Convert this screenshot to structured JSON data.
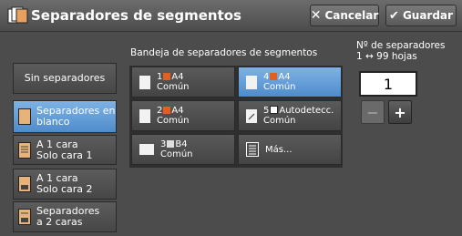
{
  "header": {
    "title": "Separadores de segmentos",
    "title_icon": "document-separator-icon",
    "cancel_label": "Cancelar",
    "save_label": "Guardar"
  },
  "left_options": [
    {
      "label_l1": "Sin separadores",
      "label_l2": "",
      "icon": "none",
      "selected": false
    },
    {
      "label_l1": "Separadores en",
      "label_l2": "blanco",
      "icon": "blank-sheet-icon",
      "selected": true
    },
    {
      "label_l1": "A 1 cara",
      "label_l2": "Solo cara 1",
      "icon": "one-sided-side1-icon",
      "selected": false
    },
    {
      "label_l1": "A 1 cara",
      "label_l2": "Solo cara 2",
      "icon": "one-sided-side2-icon",
      "selected": false
    },
    {
      "label_l1": "Separadores",
      "label_l2": "a 2 caras",
      "icon": "two-sided-icon",
      "selected": false
    }
  ],
  "tray_section": {
    "label": "Bandeja de separadores de segmentos",
    "trays": [
      {
        "line1_num": "1",
        "line1_rest": "A4",
        "line2": "Común",
        "selected": false
      },
      {
        "line1_num": "4",
        "line1_rest": "A4",
        "line2": "Común",
        "selected": true
      },
      {
        "line1_num": "2",
        "line1_rest": "A4",
        "line2": "Común",
        "selected": false
      },
      {
        "line1_num": "5",
        "line1_rest": "Autodetecc.",
        "line2": "Común",
        "selected": false
      },
      {
        "line1_num": "3",
        "line1_rest": "B4",
        "line2": "Común",
        "selected": false
      },
      {
        "line1_num": "",
        "line1_rest": "Más...",
        "line2": "",
        "selected": false
      }
    ]
  },
  "counter": {
    "label_l1": "Nº de separadores",
    "label_l2": "1 ↔ 99 hojas",
    "value": "1",
    "minus": "−",
    "plus": "+"
  },
  "colors": {
    "accent": "#5b97d3",
    "tray_orange": "#e06020"
  }
}
